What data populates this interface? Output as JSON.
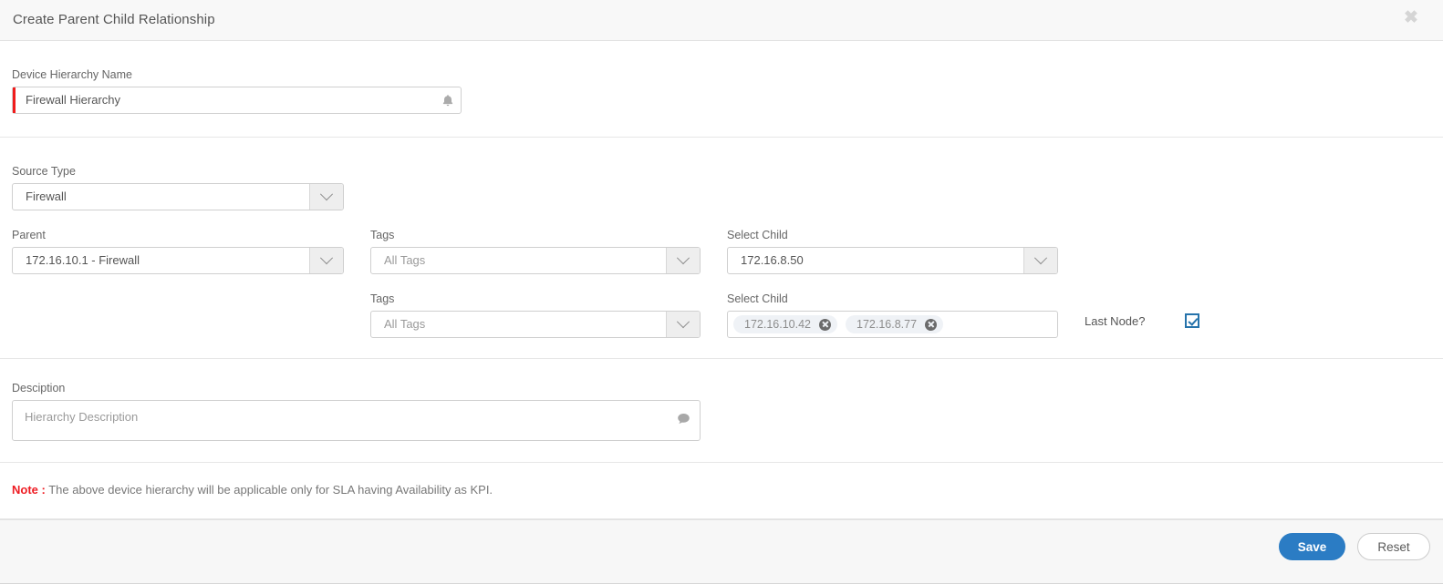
{
  "header": {
    "title": "Create Parent Child Relationship",
    "close_icon": "close-icon",
    "close_glyph": "✖"
  },
  "form": {
    "hierarchy_name": {
      "label": "Device Hierarchy Name",
      "value": "Firewall Hierarchy",
      "icon": "bell-icon",
      "invalid": true
    },
    "source_type": {
      "label": "Source Type",
      "value": "Firewall",
      "icon": "chevron-down-icon"
    },
    "parent": {
      "label": "Parent",
      "value": "172.16.10.1 - Firewall",
      "icon": "chevron-down-icon"
    },
    "tags_row1": {
      "label": "Tags",
      "value": "All Tags",
      "icon": "chevron-down-icon"
    },
    "tags_row2": {
      "label": "Tags",
      "value": "All Tags",
      "icon": "chevron-down-icon"
    },
    "child_row1": {
      "label": "Select Child",
      "value": "172.16.8.50",
      "icon": "chevron-down-icon"
    },
    "child_row2": {
      "label": "Select Child",
      "chips": [
        {
          "label": "172.16.10.42",
          "remove_icon": "remove-circle-icon"
        },
        {
          "label": "172.16.8.77",
          "remove_icon": "remove-circle-icon"
        }
      ]
    },
    "add_row": {
      "icon": "plus-circle-icon",
      "color": "#1b9ae8"
    },
    "last_node": {
      "label": "Last Node?",
      "checked": true,
      "accent": "#2673ab"
    },
    "description": {
      "label": "Desciption",
      "placeholder": "Hierarchy Description",
      "value": "",
      "icon": "comment-icon"
    }
  },
  "note": {
    "keyword": "Note :",
    "keyword_color": "#ee1c23",
    "text": "The above device hierarchy will be applicable only for SLA having Availability as KPI."
  },
  "footer": {
    "save_label": "Save",
    "save_color": "#2b7cc4",
    "reset_label": "Reset"
  }
}
